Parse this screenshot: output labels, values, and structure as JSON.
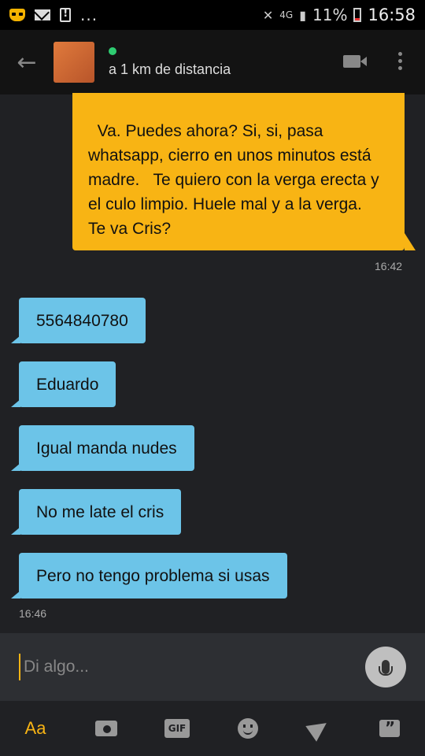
{
  "status_bar": {
    "dots": "...",
    "network": "4G",
    "battery": "11%",
    "time": "16:58"
  },
  "header": {
    "distance": "a 1 km de distancia"
  },
  "messages": {
    "sent_1": {
      "text": "Va. Puedes ahora? Si, si, pasa whatsapp, cierro en unos minutos está madre.   Te quiero con la verga erecta y el culo limpio. Huele mal y a la verga.\nTe va Cris?",
      "time": "16:42"
    },
    "recv": [
      {
        "text": "5564840780"
      },
      {
        "text": "Eduardo"
      },
      {
        "text": "Igual manda nudes"
      },
      {
        "text": "No me late el cris"
      },
      {
        "text": "Pero no tengo problema si usas"
      }
    ],
    "recv_time": "16:46"
  },
  "composer": {
    "placeholder": "Di algo..."
  },
  "toolbar": {
    "text_label": "Aa",
    "gif_label": "GIF"
  }
}
